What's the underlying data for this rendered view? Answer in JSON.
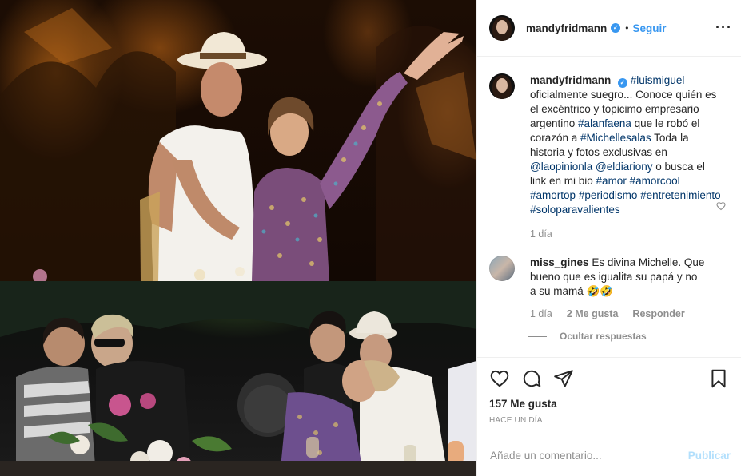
{
  "post": {
    "username": "mandyfridmann",
    "verified_mark": "✓",
    "dot": "•",
    "follow_label": "Seguir",
    "more_label": "···"
  },
  "caption": {
    "username": "mandyfridmann",
    "verified_mark": "✓",
    "mention": "#luismiguel",
    "text_1": "oficialmente suegro... Conoce quién es el excéntrico y topicimo empresario argentino ",
    "tag_alanfaena": "#alanfaena",
    "text_2": " que le robó el corazón a ",
    "tag_michellesalas": "#Michellesalas",
    "text_3": " Toda la historia y fotos exclusivas en ",
    "tag_laopinionla": "@laopinionla",
    "text_4": " ",
    "tag_eldiariony": "@eldiariony",
    "text_5": " o busca el link en mi bio ",
    "tag_amor": "#amor",
    "tag_amorcool": "#amorcool",
    "tag_amortop": "#amortop",
    "tag_periodismo": "#periodismo",
    "tag_entretenimiento": "#entretenimiento",
    "tag_soloparavalientes": "#soloparavalientes",
    "time": "1 día"
  },
  "reply": {
    "username": "miss_gines",
    "text": "Es divina Michelle. Que bueno que es igualita su papá y no a su mamá ",
    "emoji": "🤣🤣",
    "time": "1 día",
    "likes": "2 Me gusta",
    "reply_label": "Responder",
    "hide_replies_label": "Ocultar respuestas"
  },
  "actions": {
    "likes": "157 Me gusta",
    "time_ago": "HACE UN DÍA",
    "icons": [
      "heart-icon",
      "comment-icon",
      "share-icon",
      "bookmark-icon"
    ]
  },
  "add_comment": {
    "placeholder": "Añade un comentario...",
    "publish_label": "Publicar"
  },
  "colors": {
    "link_blue": "#3897f0",
    "hashtag": "#003569",
    "muted": "#8e8e8e",
    "publish_disabled": "#b2dffc"
  }
}
